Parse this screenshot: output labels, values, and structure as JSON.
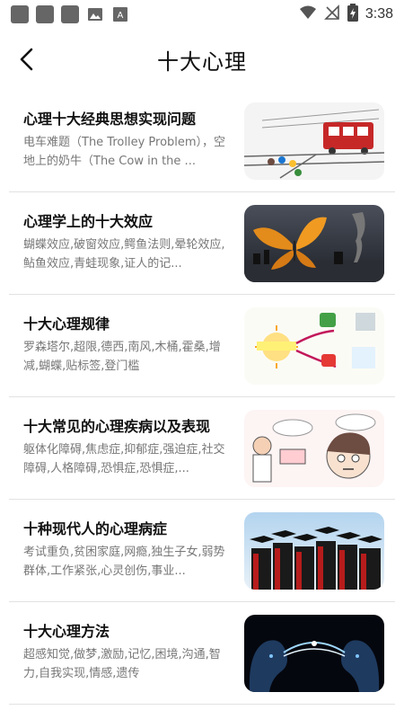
{
  "status": {
    "time": "3:38"
  },
  "header": {
    "title": "十大心理"
  },
  "items": [
    {
      "title": "心理十大经典思想实现问题",
      "desc": "电车难题（The Trolley Problem），空地上的奶牛（The Cow in the ..."
    },
    {
      "title": "心理学上的十大效应",
      "desc": "蝴蝶效应,破窗效应,鳄鱼法则,晕轮效应,鲇鱼效应,青蛙现象,证人的记..."
    },
    {
      "title": "十大心理规律",
      "desc": "罗森塔尔,超限,德西,南风,木桶,霍桑,增减,蝴蝶,贴标签,登门槛"
    },
    {
      "title": "十大常见的心理疾病以及表现",
      "desc": "躯体化障碍,焦虑症,抑郁症,强迫症,社交障碍,人格障碍,恐惧症,恐惧症,..."
    },
    {
      "title": "十种现代人的心理病症",
      "desc": "考试重负,贫困家庭,网瘾,独生子女,弱势群体,工作紧张,心灵创伤,事业..."
    },
    {
      "title": "十大心理方法",
      "desc": "超感知觉,做梦,激励,记忆,困境,沟通,智力,自我实现,情感,遗传"
    }
  ]
}
